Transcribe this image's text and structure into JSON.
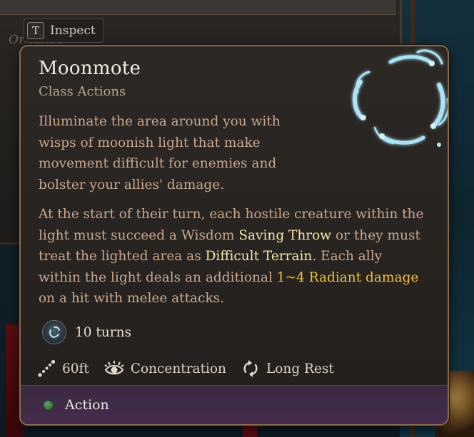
{
  "background": {
    "faded_text": "Or       lance"
  },
  "inspect_hint": {
    "key": "T",
    "label": "Inspect"
  },
  "tooltip": {
    "title": "Moonmote",
    "subtitle": "Class Actions",
    "description": "Illuminate the area around you with wisps of moonish light that make movement difficult for enemies and bolster your allies' damage.",
    "details": {
      "part1": "At the start of their turn, each hostile creature within the light must succeed a Wisdom ",
      "saving_throw": "Saving Throw",
      "part2": " or they must treat the lighted area as ",
      "difficult_terrain": "Difficult Terrain",
      "part3": ". Each ally within the light deals an additional ",
      "radiant_damage": "1~4 Radiant damage",
      "part4": " on a hit with melee attacks."
    },
    "duration": {
      "icon": "moonmote-duration-icon",
      "text": "10 turns"
    },
    "properties": [
      {
        "icon": "range-icon",
        "text": "60ft"
      },
      {
        "icon": "concentration-eye-icon",
        "text": "Concentration"
      },
      {
        "icon": "long-rest-icon",
        "text": "Long Rest"
      }
    ],
    "footer": {
      "resource": "Action",
      "resource_color": "#3f8a45"
    },
    "colors": {
      "keyword_highlight": "#f2e6a6",
      "damage_highlight": "#f0c030",
      "border": "#8c6a48"
    }
  }
}
